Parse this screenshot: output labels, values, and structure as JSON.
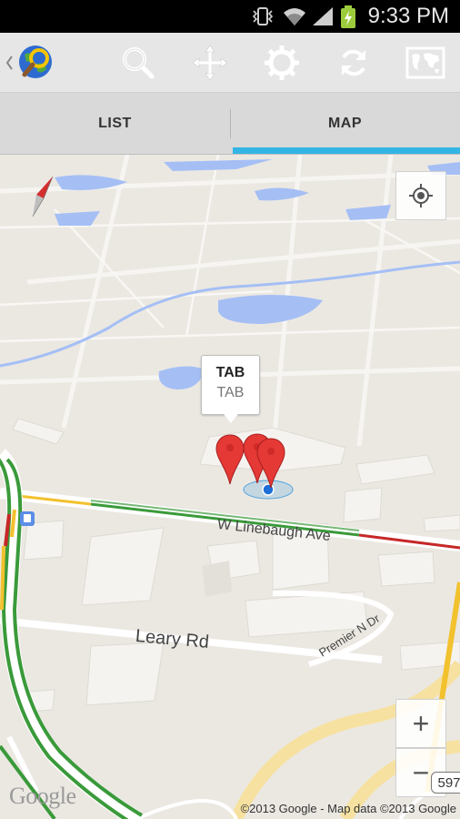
{
  "status_bar": {
    "time": "9:33 PM",
    "icons": [
      "vibrate-icon",
      "wifi-icon",
      "signal-icon",
      "battery-charging-icon"
    ]
  },
  "action_bar": {
    "app_icon": "globe-search-logo-icon",
    "actions": [
      "search-icon",
      "move-crosshair-icon",
      "settings-gear-icon",
      "refresh-icon",
      "world-map-icon"
    ]
  },
  "tabs": [
    {
      "label": "LIST",
      "selected": false
    },
    {
      "label": "MAP",
      "selected": true
    }
  ],
  "map": {
    "callout": {
      "title": "TAB",
      "subtitle": "TAB"
    },
    "roads": {
      "linebaugh": "W Linebaugh Ave",
      "leary": "Leary Rd",
      "premier": "Premier N Dr"
    },
    "route_shield": "597",
    "zoom_in": "+",
    "zoom_out": "−",
    "logo": "Google",
    "copyright": "©2013 Google - Map data ©2013 Google"
  },
  "colors": {
    "accent": "#33b5e5",
    "water": "#a5bff5",
    "map_bg": "#ebe8e2",
    "marker": "#e53935",
    "traffic_green": "#3a9a3a",
    "traffic_red": "#c62828",
    "traffic_yellow": "#f2c12e"
  }
}
